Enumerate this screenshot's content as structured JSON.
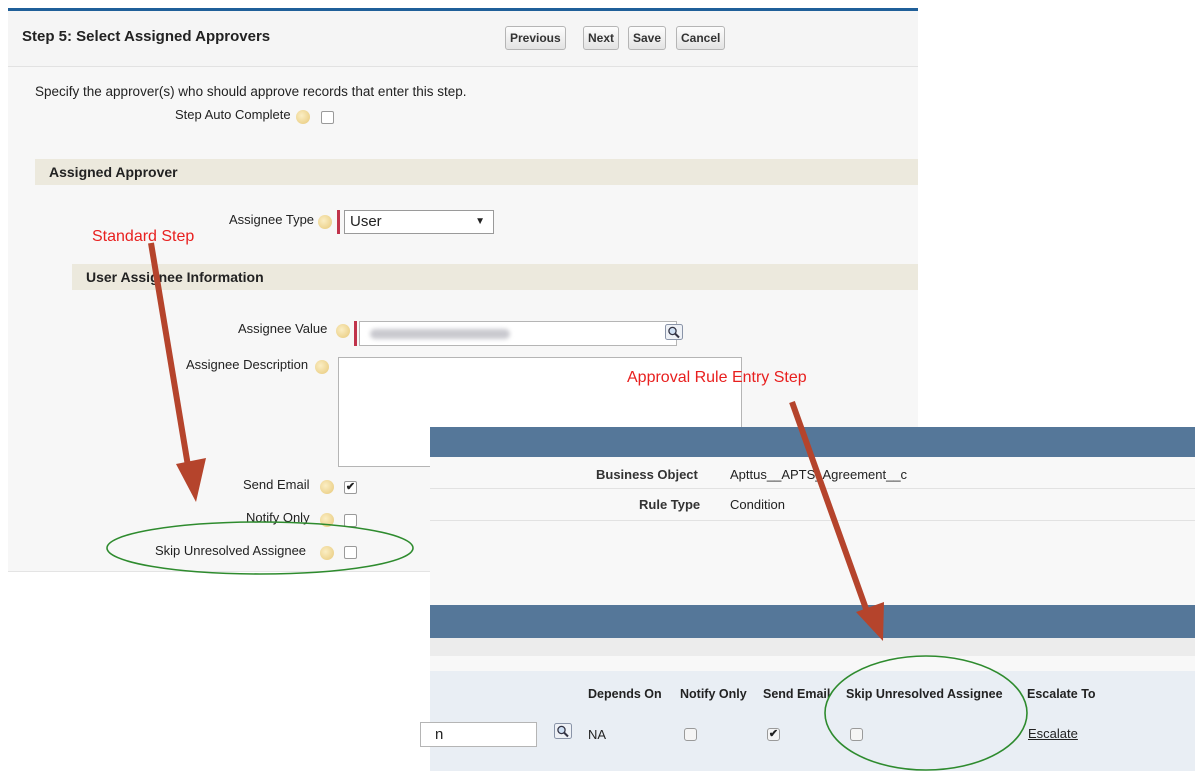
{
  "step_panel": {
    "title": "Step 5: Select Assigned Approvers",
    "buttons": {
      "previous": "Previous",
      "next": "Next",
      "save": "Save",
      "cancel": "Cancel"
    },
    "instructions": "Specify the approver(s) who should approve records that enter this step.",
    "step_auto_complete": {
      "label": "Step Auto Complete",
      "checked": false
    },
    "assigned_approver_section": "Assigned Approver",
    "assignee_type": {
      "label": "Assignee Type",
      "selected": "User"
    },
    "user_assignee_section": "User Assignee Information",
    "assignee_value_label": "Assignee Value",
    "assignee_description_label": "Assignee Description",
    "send_email": {
      "label": "Send Email",
      "checked": true
    },
    "notify_only": {
      "label": "Notify Only",
      "checked": false
    },
    "skip_unresolved": {
      "label": "Skip Unresolved Assignee",
      "checked": false
    }
  },
  "rule_panel": {
    "business_object_label": "Business Object",
    "business_object_value": "Apttus__APTS_Agreement__c",
    "rule_type_label": "Rule Type",
    "rule_type_value": "Condition",
    "columns": [
      "Depends On",
      "Notify Only",
      "Send Email",
      "Skip Unresolved Assignee",
      "Escalate To"
    ],
    "row": {
      "approver_text": "n",
      "depends_on": "NA",
      "notify_only": false,
      "send_email": true,
      "skip_unresolved": false,
      "escalate_link": "Escalate"
    }
  },
  "annotations": {
    "standard_step": "Standard Step",
    "approval_rule_entry_step": "Approval Rule Entry Step",
    "arrow_color": "#b5442c",
    "ellipse_color": "#2e8b2e",
    "text_color": "#e8201f"
  },
  "colors": {
    "header_accent": "#1f5f99",
    "section_bar": "#ece9dd",
    "rule_bar": "#557799",
    "required_marker": "#c0334b"
  }
}
